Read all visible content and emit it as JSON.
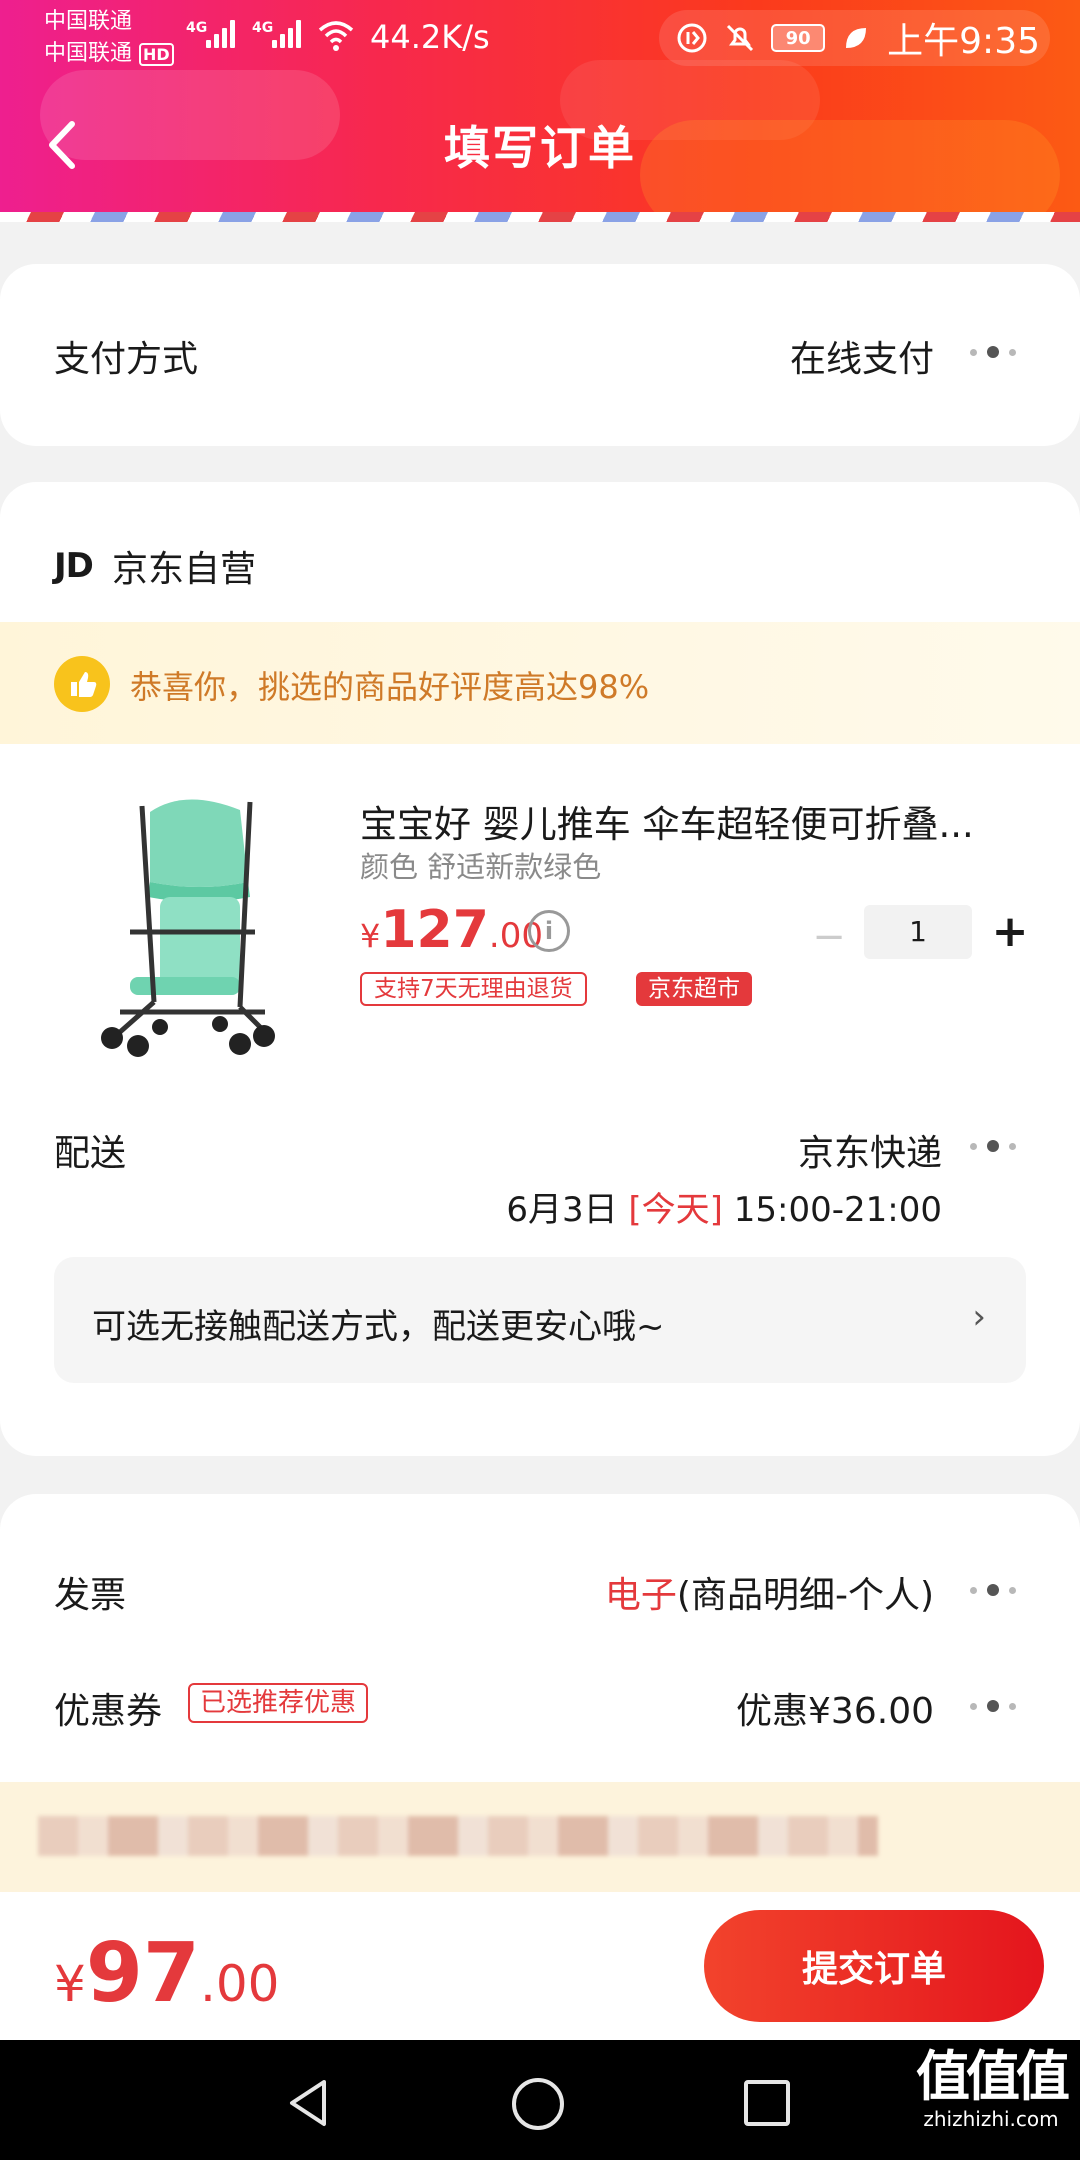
{
  "status_bar": {
    "carrier1": "中国联通",
    "carrier2": "中国联通",
    "hd": "HD",
    "signal1": "4G",
    "signal2": "4G",
    "net_speed": "44.2K/s",
    "battery": "90",
    "time": "上午9:35"
  },
  "header": {
    "title": "填写订单"
  },
  "payment": {
    "label": "支付方式",
    "value": "在线支付"
  },
  "store": {
    "logo": "JD",
    "name": "京东自营",
    "praise": "恭喜你，挑选的商品好评度高达98%"
  },
  "product": {
    "title": "宝宝好 婴儿推车 伞车超轻便可折叠...",
    "spec": "颜色 舒适新款绿色",
    "price_currency": "¥",
    "price_int": "127",
    "price_dec": ".00",
    "tag_return": "支持7天无理由退货",
    "tag_market": "京东超市",
    "quantity": "1",
    "qty_minus": "−",
    "qty_plus": "+"
  },
  "shipping": {
    "label": "配送",
    "method": "京东快递",
    "date": "6月3日",
    "today": "[今天]",
    "time": "15:00-21:00",
    "contactless": "可选无接触配送方式，配送更安心哦~",
    "arrow": "›"
  },
  "invoice": {
    "label": "发票",
    "type": "电子",
    "detail": "(商品明细-个人)"
  },
  "coupon": {
    "label": "优惠券",
    "tag": "已选推荐优惠",
    "value": "优惠¥36.00"
  },
  "bottom": {
    "currency": "¥",
    "total_int": "97",
    "total_dec": ".00",
    "submit": "提交订单"
  },
  "watermark": {
    "big": "值值值",
    "small": "zhizhizhi.com"
  },
  "colors": {
    "accent": "#e4393c",
    "praise_text": "#cf7a28",
    "header_start": "#ee1f8f",
    "header_end": "#fc5a14"
  }
}
